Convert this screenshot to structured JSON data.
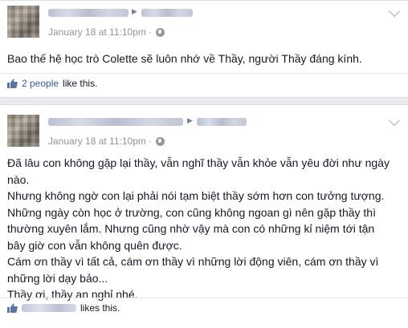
{
  "posts": [
    {
      "timestamp": "January 18 at 11:10pm",
      "audience_icon": "globe-icon",
      "body": "Bao thế hệ học trò Colette sẽ luôn nhớ về Thầy, người Thầy đáng kính.",
      "likes": {
        "count_text": "2 people",
        "tail_text": "like this."
      }
    },
    {
      "timestamp": "January 18 at 11:10pm",
      "audience_icon": "globe-icon",
      "body": "Đã lâu con không gặp lại thầy, vẫn nghĩ thầy vẫn khỏe vẫn yêu đời như ngày\nnào.\nNhưng không ngờ con lại phải nói tạm biệt thầy sớm hơn con tưởng tượng.\nNhững ngày còn học ở trường, con cũng không ngoan gì nên gặp thầy thì\nthường xuyên lắm. Nhưng cũng nhờ vậy mà con có những kỉ niệm tới tận\nbây giờ con vẫn không quên được.\nCám ơn thầy vì tất cả, cám ơn thầy vì những lời động viên, cám ơn thầy vì\nnhững lời dạy bảo...\nThầy ơi, thầy an nghỉ nhé.",
      "likes": {
        "tail_text": "likes this."
      }
    }
  ],
  "colors": {
    "link": "#3b5998",
    "meta": "#90949c",
    "text": "#141823"
  }
}
